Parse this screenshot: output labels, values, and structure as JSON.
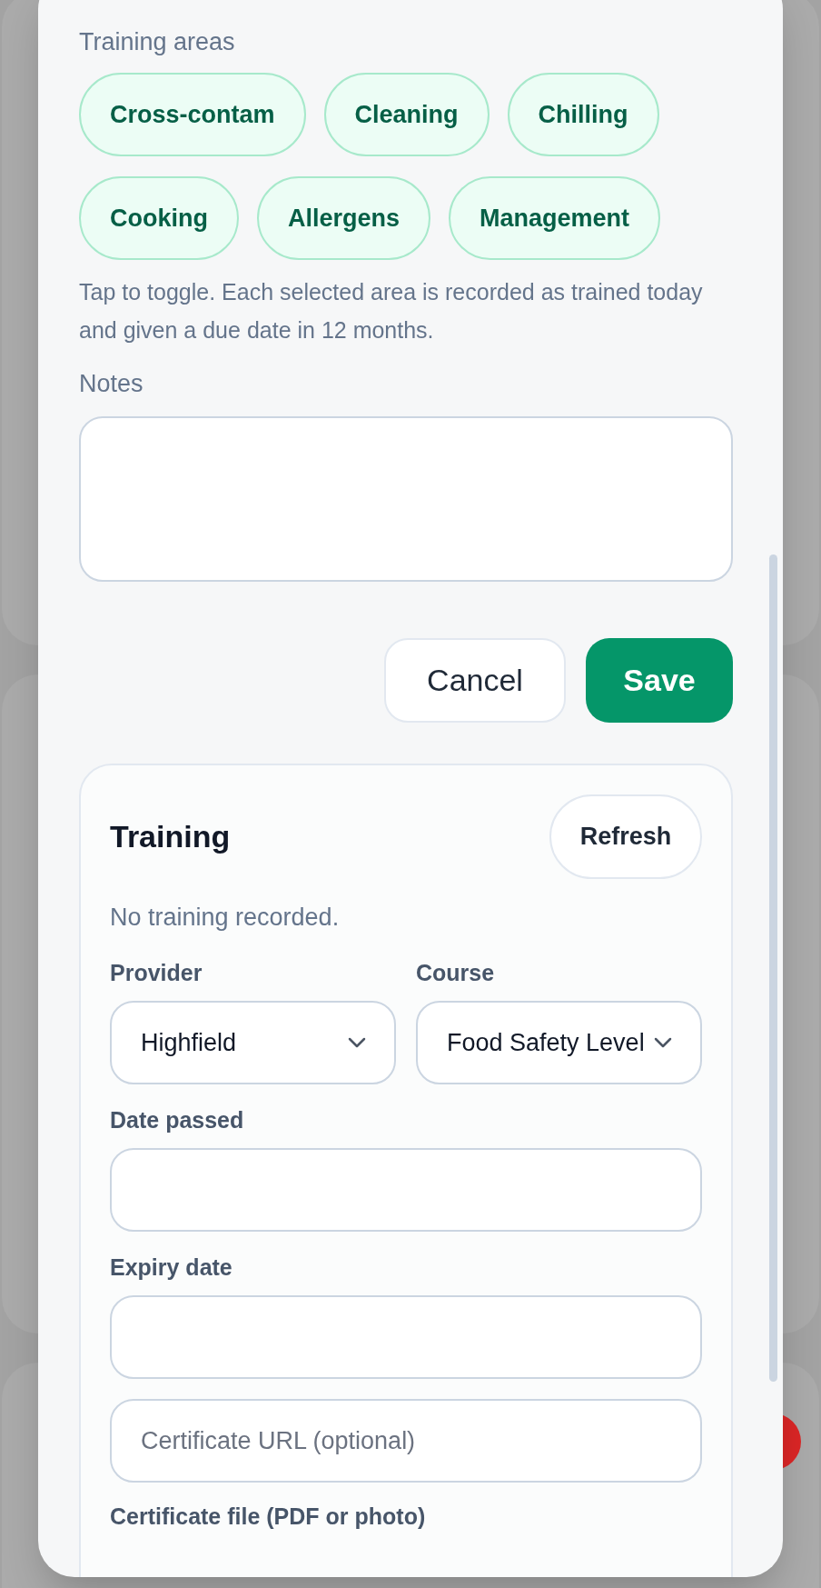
{
  "training_areas": {
    "label": "Training areas",
    "chips": [
      {
        "label": "Cross-contam",
        "selected": false
      },
      {
        "label": "Cleaning",
        "selected": false
      },
      {
        "label": "Chilling",
        "selected": false
      },
      {
        "label": "Cooking",
        "selected": false
      },
      {
        "label": "Allergens",
        "selected": false
      },
      {
        "label": "Management",
        "selected": false
      }
    ],
    "help": "Tap to toggle. Each selected area is recorded as trained today and given a due date in 12 months."
  },
  "notes": {
    "label": "Notes"
  },
  "buttons": {
    "cancel": "Cancel",
    "save": "Save"
  },
  "training": {
    "title": "Training",
    "refresh": "Refresh",
    "empty": "No training recorded.",
    "provider": {
      "label": "Provider",
      "value": "Highfield"
    },
    "course": {
      "label": "Course",
      "value": "Food Safety Level"
    },
    "date_passed": {
      "label": "Date passed"
    },
    "expiry_date": {
      "label": "Expiry date"
    },
    "certificate_url": {
      "placeholder": "Certificate URL (optional)"
    },
    "certificate_file": {
      "label": "Certificate file (PDF or photo)"
    }
  }
}
